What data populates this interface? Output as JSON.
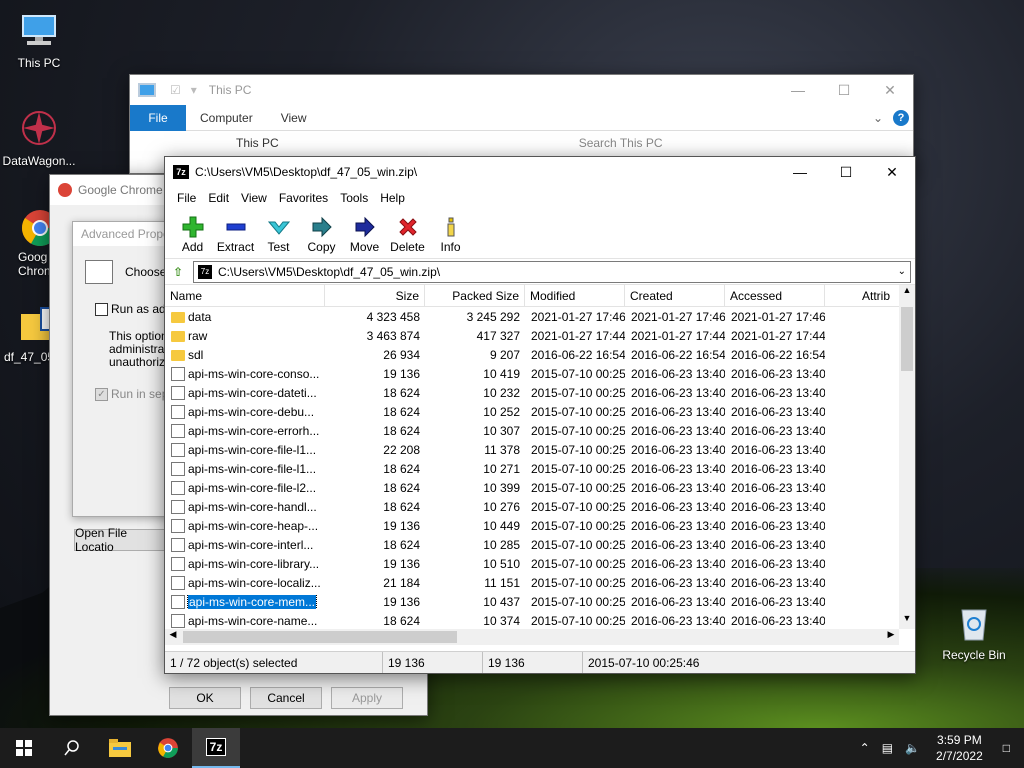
{
  "desktop": {
    "icons": [
      {
        "label": "This PC"
      },
      {
        "label": "DataWagon..."
      },
      {
        "label": "Goog Chron"
      },
      {
        "label": "df_47_05"
      },
      {
        "label": "Recycle Bin"
      }
    ]
  },
  "explorer": {
    "title": "This PC",
    "tabs": {
      "file": "File",
      "computer": "Computer",
      "view": "View"
    },
    "address": "This PC",
    "search_placeholder": "Search This PC"
  },
  "chrome_props": {
    "title": "Google Chrome",
    "adv_title": "Advanced Prope",
    "choose_text": "Choose",
    "run_as_admin": "Run as adm",
    "option_text": "This option administrat unauthoriz",
    "run_separate": "Run in sepa",
    "open_file_location": "Open File Locatio",
    "ok": "OK",
    "cancel": "Cancel",
    "apply": "Apply"
  },
  "zip": {
    "title": "C:\\Users\\VM5\\Desktop\\df_47_05_win.zip\\",
    "menu": [
      "File",
      "Edit",
      "View",
      "Favorites",
      "Tools",
      "Help"
    ],
    "toolbar": {
      "add": "Add",
      "extract": "Extract",
      "test": "Test",
      "copy": "Copy",
      "move": "Move",
      "delete": "Delete",
      "info": "Info"
    },
    "address": "C:\\Users\\VM5\\Desktop\\df_47_05_win.zip\\",
    "columns": {
      "name": "Name",
      "size": "Size",
      "packed": "Packed Size",
      "modified": "Modified",
      "created": "Created",
      "accessed": "Accessed",
      "attrib": "Attrib"
    },
    "rows": [
      {
        "name": "data",
        "size": "4 323 458",
        "packed": "3 245 292",
        "modified": "2021-01-27 17:46",
        "created": "2021-01-27 17:46",
        "accessed": "2021-01-27 17:46",
        "type": "folder"
      },
      {
        "name": "raw",
        "size": "3 463 874",
        "packed": "417 327",
        "modified": "2021-01-27 17:44",
        "created": "2021-01-27 17:44",
        "accessed": "2021-01-27 17:44",
        "type": "folder"
      },
      {
        "name": "sdl",
        "size": "26 934",
        "packed": "9 207",
        "modified": "2016-06-22 16:54",
        "created": "2016-06-22 16:54",
        "accessed": "2016-06-22 16:54",
        "type": "folder"
      },
      {
        "name": "api-ms-win-core-conso...",
        "size": "19 136",
        "packed": "10 419",
        "modified": "2015-07-10 00:25",
        "created": "2016-06-23 13:40",
        "accessed": "2016-06-23 13:40",
        "type": "dll"
      },
      {
        "name": "api-ms-win-core-dateti...",
        "size": "18 624",
        "packed": "10 232",
        "modified": "2015-07-10 00:25",
        "created": "2016-06-23 13:40",
        "accessed": "2016-06-23 13:40",
        "type": "dll"
      },
      {
        "name": "api-ms-win-core-debu...",
        "size": "18 624",
        "packed": "10 252",
        "modified": "2015-07-10 00:25",
        "created": "2016-06-23 13:40",
        "accessed": "2016-06-23 13:40",
        "type": "dll"
      },
      {
        "name": "api-ms-win-core-errorh...",
        "size": "18 624",
        "packed": "10 307",
        "modified": "2015-07-10 00:25",
        "created": "2016-06-23 13:40",
        "accessed": "2016-06-23 13:40",
        "type": "dll"
      },
      {
        "name": "api-ms-win-core-file-l1...",
        "size": "22 208",
        "packed": "11 378",
        "modified": "2015-07-10 00:25",
        "created": "2016-06-23 13:40",
        "accessed": "2016-06-23 13:40",
        "type": "dll"
      },
      {
        "name": "api-ms-win-core-file-l1...",
        "size": "18 624",
        "packed": "10 271",
        "modified": "2015-07-10 00:25",
        "created": "2016-06-23 13:40",
        "accessed": "2016-06-23 13:40",
        "type": "dll"
      },
      {
        "name": "api-ms-win-core-file-l2...",
        "size": "18 624",
        "packed": "10 399",
        "modified": "2015-07-10 00:25",
        "created": "2016-06-23 13:40",
        "accessed": "2016-06-23 13:40",
        "type": "dll"
      },
      {
        "name": "api-ms-win-core-handl...",
        "size": "18 624",
        "packed": "10 276",
        "modified": "2015-07-10 00:25",
        "created": "2016-06-23 13:40",
        "accessed": "2016-06-23 13:40",
        "type": "dll"
      },
      {
        "name": "api-ms-win-core-heap-...",
        "size": "19 136",
        "packed": "10 449",
        "modified": "2015-07-10 00:25",
        "created": "2016-06-23 13:40",
        "accessed": "2016-06-23 13:40",
        "type": "dll"
      },
      {
        "name": "api-ms-win-core-interl...",
        "size": "18 624",
        "packed": "10 285",
        "modified": "2015-07-10 00:25",
        "created": "2016-06-23 13:40",
        "accessed": "2016-06-23 13:40",
        "type": "dll"
      },
      {
        "name": "api-ms-win-core-library...",
        "size": "19 136",
        "packed": "10 510",
        "modified": "2015-07-10 00:25",
        "created": "2016-06-23 13:40",
        "accessed": "2016-06-23 13:40",
        "type": "dll"
      },
      {
        "name": "api-ms-win-core-localiz...",
        "size": "21 184",
        "packed": "11 151",
        "modified": "2015-07-10 00:25",
        "created": "2016-06-23 13:40",
        "accessed": "2016-06-23 13:40",
        "type": "dll"
      },
      {
        "name": "api-ms-win-core-mem...",
        "size": "19 136",
        "packed": "10 437",
        "modified": "2015-07-10 00:25",
        "created": "2016-06-23 13:40",
        "accessed": "2016-06-23 13:40",
        "type": "dll",
        "selected": true
      },
      {
        "name": "api-ms-win-core-name...",
        "size": "18 624",
        "packed": "10 374",
        "modified": "2015-07-10 00:25",
        "created": "2016-06-23 13:40",
        "accessed": "2016-06-23 13:40",
        "type": "dll"
      }
    ],
    "status": {
      "selection": "1 / 72 object(s) selected",
      "size": "19 136",
      "packed": "19 136",
      "modified": "2015-07-10 00:25:46"
    }
  },
  "taskbar": {
    "time": "3:59 PM",
    "date": "2/7/2022",
    "zip_label": "7z"
  },
  "colors": {
    "accent": "#0078d7",
    "ribbon_file": "#1979ca",
    "folder": "#f6c93f"
  }
}
